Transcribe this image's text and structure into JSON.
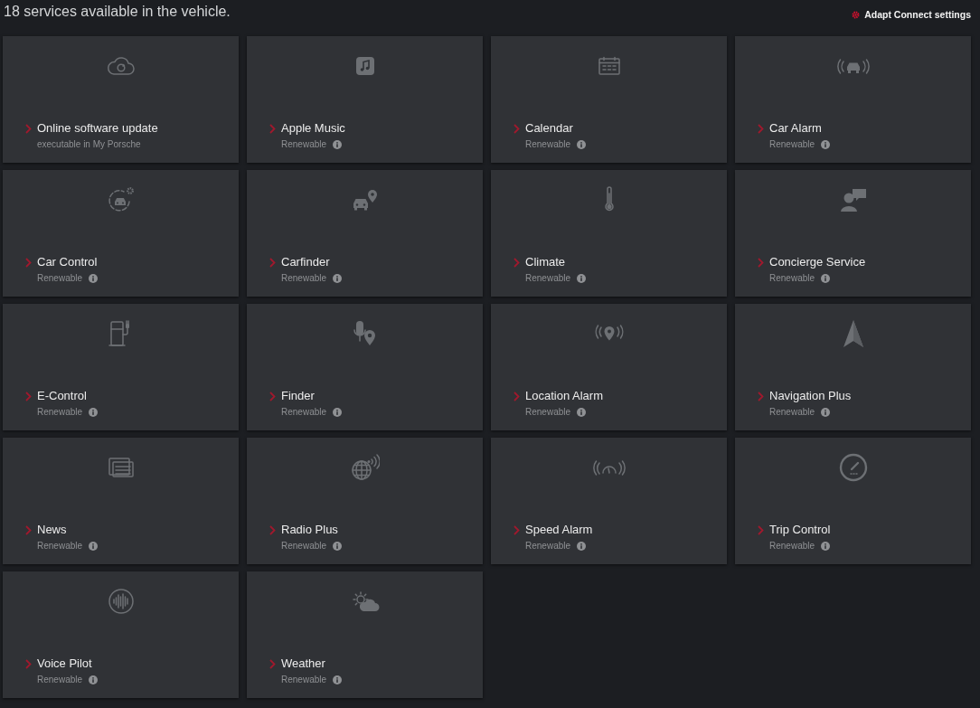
{
  "header": {
    "title": "18 services available in the vehicle.",
    "settings_link": "Adapt Connect settings"
  },
  "services": [
    {
      "title": "Online software update",
      "subtitle": "executable in My Porsche",
      "info": false
    },
    {
      "title": "Apple Music",
      "subtitle": "Renewable",
      "info": true
    },
    {
      "title": "Calendar",
      "subtitle": "Renewable",
      "info": true
    },
    {
      "title": "Car Alarm",
      "subtitle": "Renewable",
      "info": true
    },
    {
      "title": "Car Control",
      "subtitle": "Renewable",
      "info": true
    },
    {
      "title": "Carfinder",
      "subtitle": "Renewable",
      "info": true
    },
    {
      "title": "Climate",
      "subtitle": "Renewable",
      "info": true
    },
    {
      "title": "Concierge Service",
      "subtitle": "Renewable",
      "info": true
    },
    {
      "title": "E-Control",
      "subtitle": "Renewable",
      "info": true
    },
    {
      "title": "Finder",
      "subtitle": "Renewable",
      "info": true
    },
    {
      "title": "Location Alarm",
      "subtitle": "Renewable",
      "info": true
    },
    {
      "title": "Navigation Plus",
      "subtitle": "Renewable",
      "info": true
    },
    {
      "title": "News",
      "subtitle": "Renewable",
      "info": true
    },
    {
      "title": "Radio Plus",
      "subtitle": "Renewable",
      "info": true
    },
    {
      "title": "Speed Alarm",
      "subtitle": "Renewable",
      "info": true
    },
    {
      "title": "Trip Control",
      "subtitle": "Renewable",
      "info": true
    },
    {
      "title": "Voice Pilot",
      "subtitle": "Renewable",
      "info": true
    },
    {
      "title": "Weather",
      "subtitle": "Renewable",
      "info": true
    }
  ]
}
